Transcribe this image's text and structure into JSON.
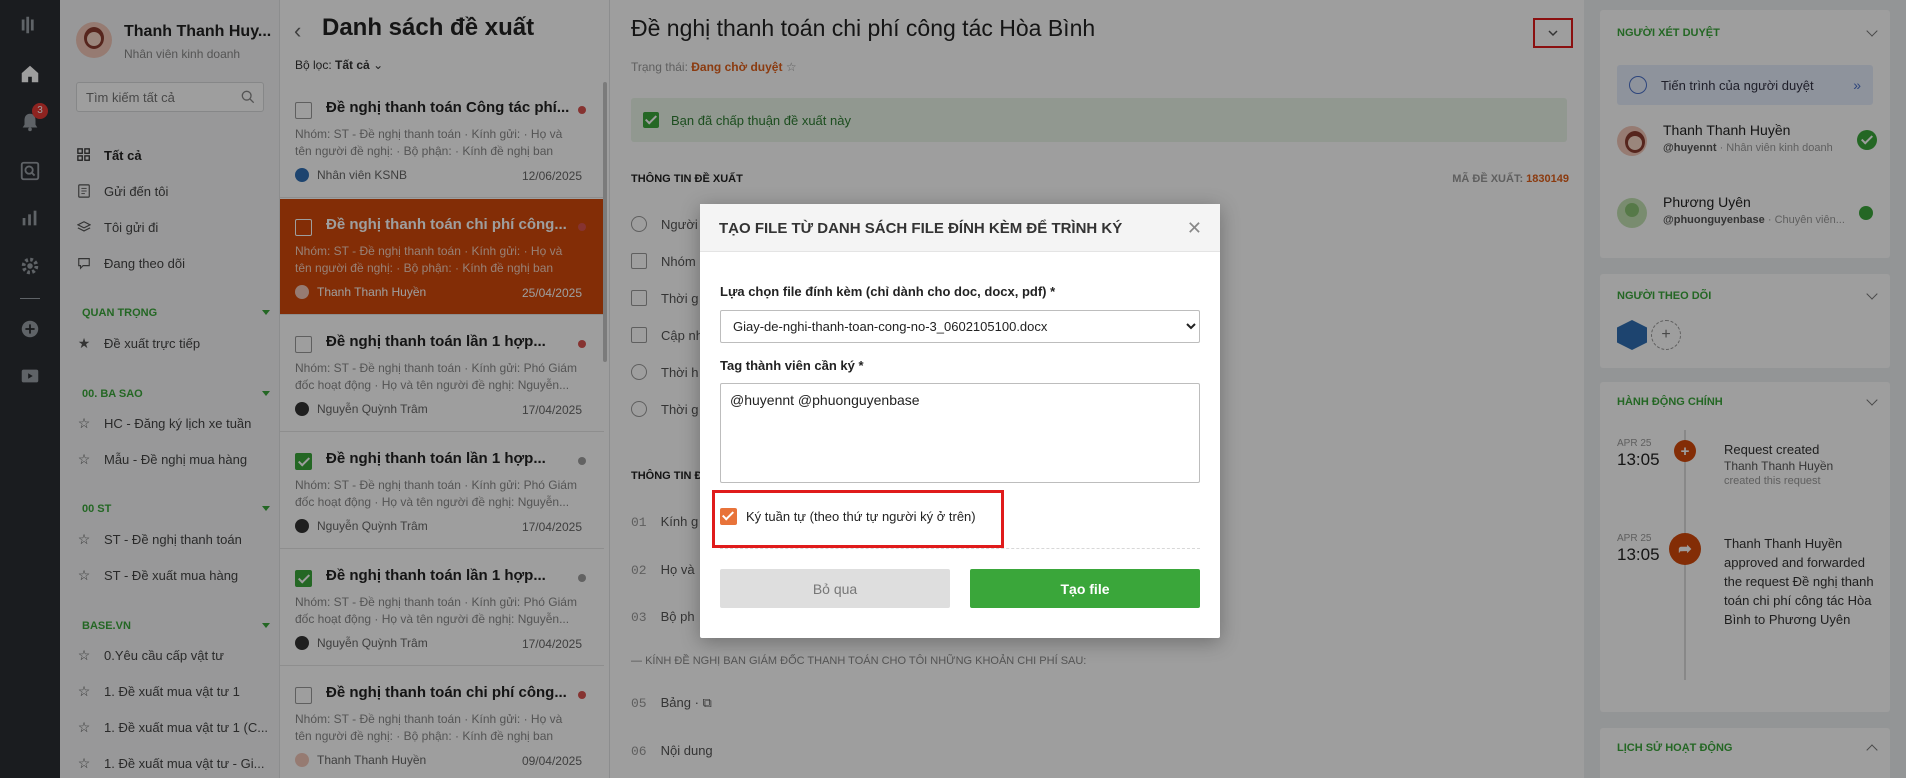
{
  "rail": {
    "notification_count": "3"
  },
  "sidebar": {
    "user_name": "Thanh Thanh Huy...",
    "user_role": "Nhân viên kinh doanh",
    "search_placeholder": "Tìm kiếm tất cả",
    "items": [
      {
        "label": "Tất cả",
        "icon": "grid-icon"
      },
      {
        "label": "Gửi đến tôi",
        "icon": "inbox-icon"
      },
      {
        "label": "Tôi gửi đi",
        "icon": "layers-icon"
      },
      {
        "label": "Đang theo dõi",
        "icon": "chat-icon"
      }
    ],
    "groups": [
      {
        "title": "QUAN TRỌNG",
        "items": [
          "Đề xuất trực tiếp"
        ]
      },
      {
        "title": "00. BA SAO",
        "items": [
          "HC - Đăng ký lịch xe tuần",
          "Mẫu - Đề nghị mua hàng"
        ]
      },
      {
        "title": "00 ST",
        "items": [
          "ST - Đề nghị thanh toán",
          "ST - Đề xuất mua hàng"
        ]
      },
      {
        "title": "BASE.VN",
        "items": [
          "0.Yêu cầu cấp vật tư",
          "1. Đề xuất mua vật tư 1",
          "1. Đề xuất mua vật tư 1 (C...",
          "1. Đề xuất mua vật tư - Gi..."
        ]
      }
    ]
  },
  "list": {
    "title": "Danh sách đề xuất",
    "filter_label": "Bộ lọc:",
    "filter_value": "Tất cả",
    "cards": [
      {
        "title": "Đề nghị thanh toán Công tác phí...",
        "desc": "Nhóm: ST - Đề nghị thanh toán · Kính gửi: · Họ và tên người đề nghị: · Bộ phận: · Kính đề nghị ban giám đốc...",
        "author": "Nhân viên KSNB",
        "date": "12/06/2025",
        "dot": "#d9534f",
        "checked": false
      },
      {
        "title": "Đề nghị thanh toán chi phí công...",
        "desc": "Nhóm: ST - Đề nghị thanh toán · Kính gửi: · Họ và tên người đề nghị: · Bộ phận: · Kính đề nghị ban giám đốc...",
        "author": "Thanh Thanh Huyền",
        "date": "25/04/2025",
        "dot": "#d9534f",
        "checked": false
      },
      {
        "title": "Đề nghị thanh toán lần 1 hợp...",
        "desc": "Nhóm: ST - Đề nghị thanh toán · Kính gửi: Phó Giám đốc hoạt động · Họ và tên người đề nghị: Nguyễn...",
        "author": "Nguyễn Quỳnh Trâm",
        "date": "17/04/2025",
        "dot": "#d9534f",
        "checked": false
      },
      {
        "title": "Đề nghị thanh toán lần 1 hợp...",
        "desc": "Nhóm: ST - Đề nghị thanh toán · Kính gửi: Phó Giám đốc hoạt động · Họ và tên người đề nghị: Nguyễn...",
        "author": "Nguyễn Quỳnh Trâm",
        "date": "17/04/2025",
        "dot": "#9e9e9e",
        "checked": true
      },
      {
        "title": "Đề nghị thanh toán lần 1 hợp...",
        "desc": "Nhóm: ST - Đề nghị thanh toán · Kính gửi: Phó Giám đốc hoạt động · Họ và tên người đề nghị: Nguyễn...",
        "author": "Nguyễn Quỳnh Trâm",
        "date": "17/04/2025",
        "dot": "#9e9e9e",
        "checked": true
      },
      {
        "title": "Đề nghị thanh toán chi phí công...",
        "desc": "Nhóm: ST - Đề nghị thanh toán · Kính gửi: · Họ và tên người đề nghị: · Bộ phận: · Kính đề nghị ban giám đốc...",
        "author": "Thanh Thanh Huyền",
        "date": "09/04/2025",
        "dot": "#d9534f",
        "checked": false
      }
    ]
  },
  "detail": {
    "title": "Đề nghị thanh toán chi phí công tác Hòa Bình",
    "status_label": "Trạng thái:",
    "status_value": "Đang chờ duyệt",
    "approved_text": "Bạn đã chấp thuận đề xuất này",
    "section_info": "THÔNG TIN ĐỀ XUẤT",
    "code_label": "MÃ ĐỀ XUẤT:",
    "code_value": "1830149",
    "fields": [
      "Người",
      "Nhóm",
      "Thời g",
      "Cập nh",
      "Thời h",
      "Thời g"
    ],
    "section_info2": "THÔNG TIN Đ",
    "numbered": [
      {
        "num": "01",
        "label": "Kính g"
      },
      {
        "num": "02",
        "label": "Họ và"
      },
      {
        "num": "03",
        "label": "Bộ ph"
      },
      {
        "num": "05",
        "label": "Bảng ·"
      },
      {
        "num": "06",
        "label": "Nội dung"
      }
    ],
    "dash_label": "KÍNH ĐỀ NGHỊ BAN GIÁM ĐỐC THANH TOÁN CHO TÔI NHỮNG KHOẢN CHI PHÍ SAU:"
  },
  "right": {
    "approvers_title": "NGƯỜI XÉT DUYỆT",
    "progress_label": "Tiến trình của người duyệt",
    "approvers": [
      {
        "name": "Thanh Thanh Huyền",
        "handle": "@huyennt",
        "role": "Nhân viên kinh doanh"
      },
      {
        "name": "Phương Uyên",
        "handle": "@phuonguyenbase",
        "role": "Chuyên viên..."
      }
    ],
    "followers_title": "NGƯỜI THEO DÕI",
    "actions_title": "HÀNH ĐỘNG CHÍNH",
    "timeline": [
      {
        "month": "APR 25",
        "time": "13:05",
        "title": "Request created",
        "actor": "Thanh Thanh Huyền",
        "note": "created this request"
      },
      {
        "month": "APR 25",
        "time": "13:05",
        "actor": "Thanh Thanh Huyền",
        "text_a": "approved and forwarded the request",
        "req": "Đề nghị thanh toán chi phí công tác Hòa Bình",
        "text_b": "to",
        "target": "Phương Uyên"
      }
    ],
    "history_title": "LỊCH SỬ HOẠT ĐỘNG"
  },
  "modal": {
    "title": "TẠO FILE TỪ DANH SÁCH FILE ĐÍNH KÈM ĐỂ TRÌNH KÝ",
    "file_label": "Lựa chọn file đính kèm (chỉ dành cho doc, docx, pdf) *",
    "file_selected": "Giay-de-nghi-thanh-toan-cong-no-3_0602105100.docx",
    "tag_label": "Tag thành viên cần ký *",
    "tag_value": "@huyennt @phuonguyenbase",
    "sequential_label": "Ký tuần tự (theo thứ tự người ký ở trên)",
    "skip_label": "Bỏ qua",
    "create_label": "Tạo file"
  }
}
